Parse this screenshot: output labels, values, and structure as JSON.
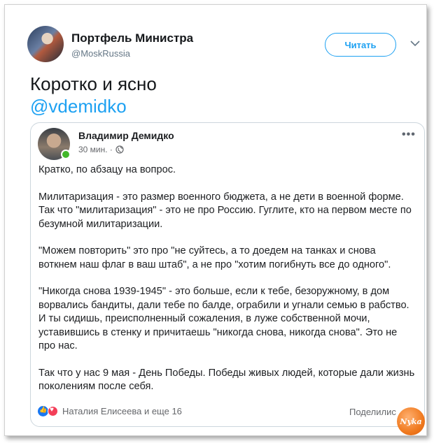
{
  "header": {
    "author_name": "Портфель Министра",
    "author_handle": "@MoskRussia",
    "read_button": "Читать"
  },
  "tweet": {
    "text": "Коротко и ясно",
    "mention": "@vdemidko"
  },
  "embedded_post": {
    "author_name": "Владимир Демидко",
    "time": "30 мин. ·",
    "more": "•••",
    "paragraphs": [
      "Кратко, по абзацу на вопрос.",
      "Милитаризация - это размер военного бюджета, а не дети в военной форме. Так что \"милитаризация\" - это не про Россию. Гуглите, кто на первом месте по безумной милитаризации.",
      "\"Можем повторить\" это про \"не суйтесь, а то доедем на танках и снова воткнем наш флаг в ваш штаб\", а не про \"хотим погибнуть все до одного\".",
      "\"Никогда снова 1939-1945\" - это больше, если к тебе, безоружному, в дом ворвались бандиты, дали тебе по балде, ограбили и угнали семью в рабство. И ты сидишь, преисполненный сожаления, в луже собственной мочи, уставившись в стенку и причитаешь \"никогда снова, никогда снова\". Это не про нас.",
      "Так что у нас 9 мая - День Победы. Победы живых людей, которые дали жизнь поколениям после себя."
    ],
    "reactions_text": "Наталия Елисеева и еще 16",
    "share_label": "Поделилис"
  },
  "watermark": {
    "text": "Nyka"
  },
  "colors": {
    "accent": "#1da1f2",
    "online": "#42b72a",
    "like": "#1877f2",
    "love": "#f33e58"
  },
  "icons": [
    "chevron-down-icon",
    "globe-icon",
    "like-reaction-icon",
    "love-reaction-icon",
    "more-options-icon"
  ]
}
